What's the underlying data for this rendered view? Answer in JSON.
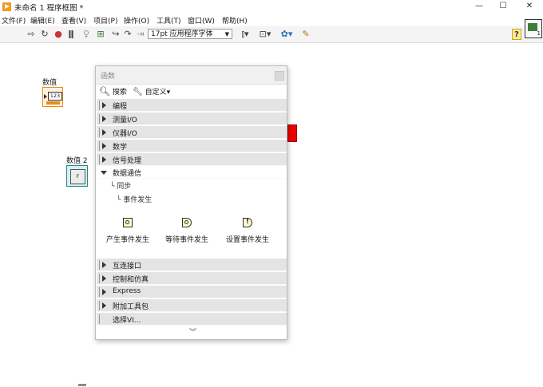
{
  "window": {
    "title": "未命名 1 程序框图 *",
    "minimize": "—",
    "maximize": "☐",
    "close": "✕"
  },
  "menubar": {
    "items": [
      "文件(F)",
      "编辑(E)",
      "查看(V)",
      "项目(P)",
      "操作(O)",
      "工具(T)",
      "窗口(W)",
      "帮助(H)"
    ]
  },
  "toolbar": {
    "font": "17pt 应用程序字体",
    "help": "?",
    "vi_icon_number": "1"
  },
  "canvas": {
    "numeric1": {
      "label": "数值",
      "display": "123"
    },
    "numeric2": {
      "label": "数值 2",
      "display": "F"
    }
  },
  "palette": {
    "title": "函数",
    "search": "搜索",
    "customize": "自定义▾",
    "categories_top": [
      "编程",
      "测量I/O",
      "仪器I/O",
      "数学",
      "信号处理"
    ],
    "expanded": {
      "label": "数据通信",
      "path1": "└ 同步",
      "path2": "└ 事件发生",
      "items": [
        "产生事件发生",
        "等待事件发生",
        "设置事件发生"
      ]
    },
    "categories_bottom": [
      "互连接口",
      "控制和仿真",
      "Express",
      "附加工具包"
    ],
    "select_vi": "选择VI...",
    "more": "︾"
  },
  "colors": {
    "numeric_orange": "#e98b1b",
    "accent_red": "#ee0000",
    "app_orange": "#f39a1b"
  }
}
